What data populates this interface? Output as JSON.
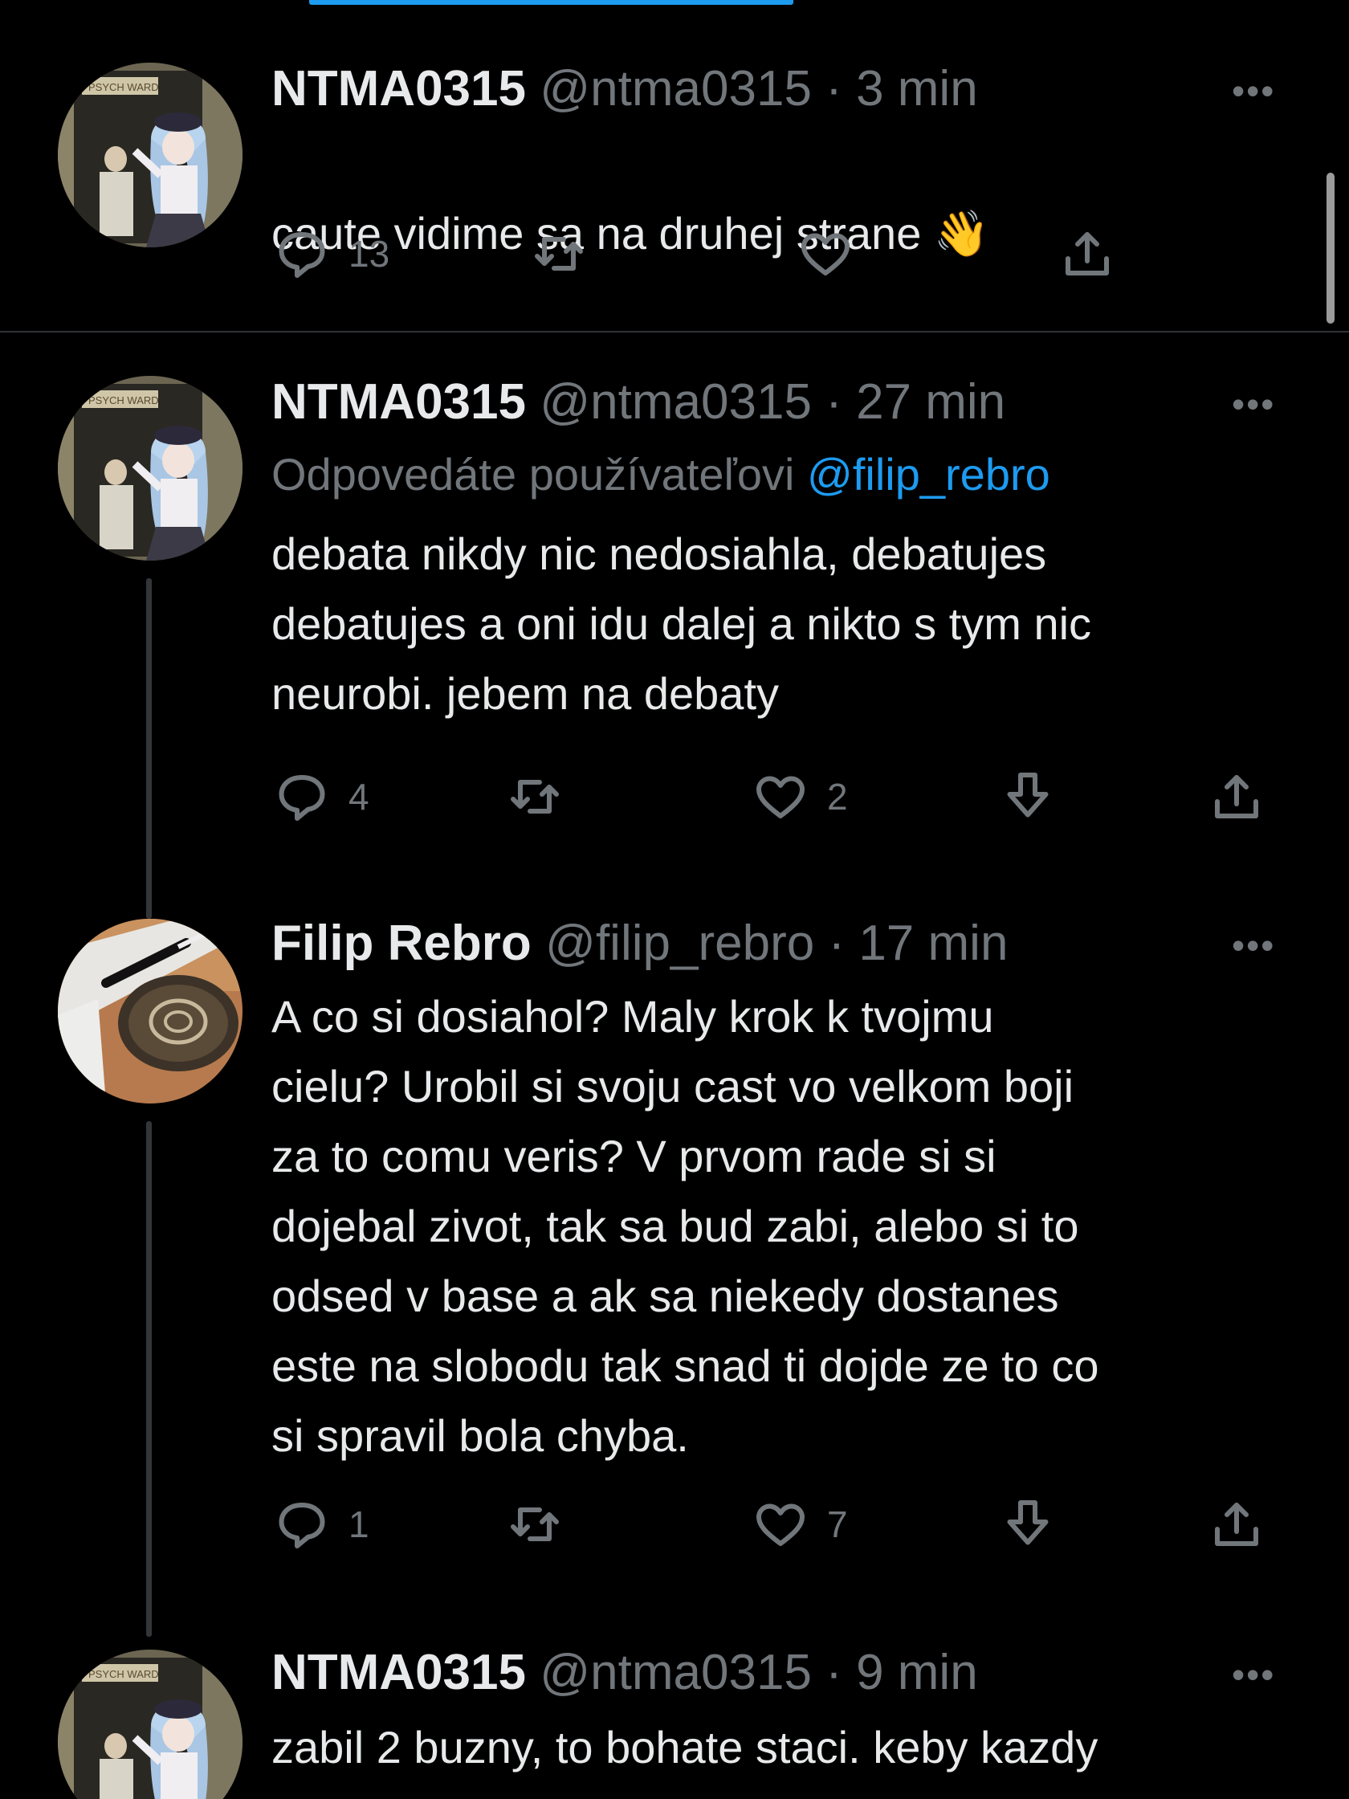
{
  "tweets": [
    {
      "name": "NTMA0315",
      "handle": "@ntma0315",
      "dot": "·",
      "time": "3 min",
      "avatar_text": "PSYCH WARD",
      "text": "caute vidime sa na druhej strane",
      "emoji": "👋",
      "more": "•••",
      "counts": {
        "reply": "13",
        "retweet": "",
        "like": ""
      }
    },
    {
      "name": "NTMA0315",
      "handle": "@ntma0315",
      "dot": "·",
      "time": "27 min",
      "avatar_text": "PSYCH WARD",
      "reply_prefix": "Odpovedáte používateľovi",
      "reply_mention": "@filip_rebro",
      "text": "debata nikdy nic nedosiahla, debatujes\ndebatujes a oni idu dalej a nikto s tym nic\nneurobi. jebem na debaty",
      "more": "•••",
      "counts": {
        "reply": "4",
        "retweet": "",
        "like": "2"
      }
    },
    {
      "name": "Filip Rebro",
      "handle": "@filip_rebro",
      "dot": "·",
      "time": "17 min",
      "text": "A co si dosiahol? Maly krok k tvojmu\ncielu? Urobil si svoju cast vo velkom boji\nza to comu veris? V prvom rade si si\ndojebal zivot, tak sa bud zabi, alebo si to\nodsed v base a ak sa niekedy dostanes\neste na slobodu tak snad ti dojde ze to co\nsi spravil bola chyba.",
      "more": "•••",
      "counts": {
        "reply": "1",
        "retweet": "",
        "like": "7"
      }
    },
    {
      "name": "NTMA0315",
      "handle": "@ntma0315",
      "dot": "·",
      "time": "9 min",
      "avatar_text": "PSYCH WARD",
      "text": "zabil 2 buzny, to bohate staci. keby kazdy",
      "more": "•••"
    }
  ],
  "colors": {
    "background": "#000000",
    "text": "#e7e9ea",
    "secondary": "#71767b",
    "accent": "#1d9bf0",
    "divider": "#2f3336"
  }
}
